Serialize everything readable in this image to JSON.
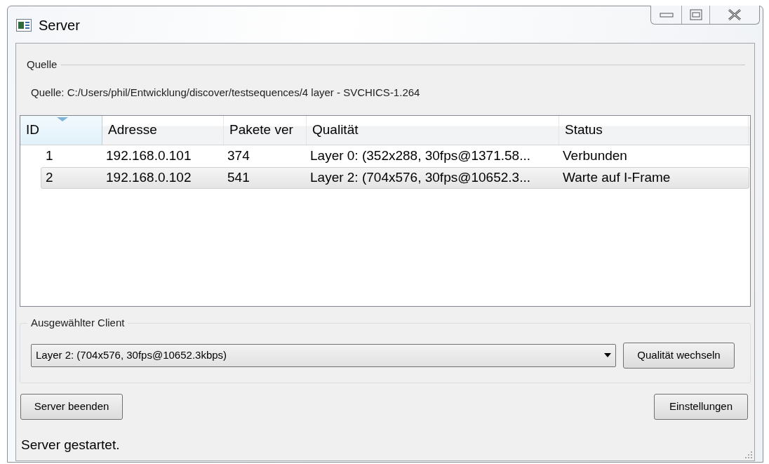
{
  "window": {
    "title": "Server"
  },
  "source_group": {
    "title": "Quelle",
    "text": "Quelle: C:/Users/phil/Entwicklung/discover/testsequences/4 layer - SVCHICS-1.264"
  },
  "table": {
    "columns": [
      {
        "label": "ID",
        "sorted": true
      },
      {
        "label": "Adresse",
        "sorted": false
      },
      {
        "label": "Pakete ver",
        "sorted": false
      },
      {
        "label": "Qualität",
        "sorted": false
      },
      {
        "label": "Status",
        "sorted": false
      }
    ],
    "rows": [
      {
        "selected": false,
        "cells": [
          "1",
          "192.168.0.101",
          "374",
          "Layer 0: (352x288, 30fps@1371.58...",
          "Verbunden"
        ]
      },
      {
        "selected": true,
        "cells": [
          "2",
          "192.168.0.102",
          "541",
          "Layer 2: (704x576, 30fps@10652.3...",
          "Warte auf I-Frame"
        ]
      }
    ]
  },
  "client_group": {
    "title": "Ausgewählter Client",
    "dropdown_value": "Layer 2: (704x576, 30fps@10652.3kbps)",
    "button": "Qualität wechseln"
  },
  "buttons": [
    "Server beenden",
    "Einstellungen"
  ],
  "status_bar": "Server gestartet."
}
